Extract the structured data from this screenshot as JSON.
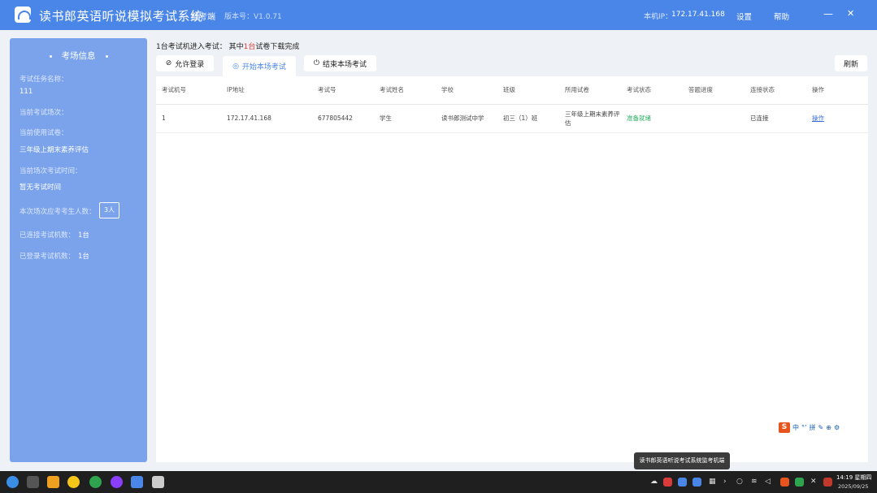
{
  "window": {
    "app_title": "读书郎英语听说模拟考试系统",
    "role": "监考端",
    "version": "版本号：V1.0.71",
    "local_ip_label": "本机IP：",
    "local_ip_value": "172.17.41.168",
    "menu_settings": "设置",
    "menu_help": "帮助",
    "minimize": "—",
    "close": "✕"
  },
  "left_panel": {
    "title": "考场信息",
    "task_name_label": "考试任务名称：",
    "task_name_value": "111",
    "current_session_label": "当前考试场次：",
    "current_paper_label": "当前使用试卷：",
    "current_paper_value": "三年级上期末素养评估",
    "exam_time_label": "当前场次考试时间：",
    "exam_time_value": "暂无考试时间",
    "expected_count_label": "本次场次应考考生人数：",
    "expected_count_value": "3人",
    "connected_label": "已连接考试机数：",
    "connected_value": "1台",
    "logged_in_label": "已登录考试机数：",
    "logged_in_value": "1台"
  },
  "summary": {
    "prefix": "1台考试机进入考试：  其中",
    "highlight": "1台",
    "suffix": "试卷下载完成"
  },
  "toolbar": {
    "allow_login": "允许登录",
    "start_exam": "开始本场考试",
    "end_exam": "结束本场考试",
    "refresh": "刷新"
  },
  "table": {
    "headers": [
      "考试机号",
      "IP地址",
      "考试号",
      "考试姓名",
      "学校",
      "班级",
      "所用试卷",
      "考试状态",
      "答题进度",
      "连接状态",
      "操作"
    ],
    "rows": [
      {
        "machine_no": "1",
        "ip": "172.17.41.168",
        "exam_no": "677805442",
        "name": "学生",
        "school": "读书郎测试中学",
        "class": "初三（1）班",
        "paper": "三年级上期末素养评估",
        "status": "准备就绪",
        "progress": "",
        "connection": "已连接",
        "action": "操作"
      }
    ]
  },
  "ime": {
    "items": [
      "中",
      "°’",
      "拼",
      "✎",
      "⊕",
      "⚙"
    ]
  },
  "tooltip": "读书郎英语听说考试系统监考机端",
  "taskbar": {
    "time": "14:19 星期四",
    "date": "2025/09/25"
  },
  "colors": {
    "titlebar": "#4a86e8",
    "panel": "#7aa3ec",
    "status_ready": "#27ae60",
    "highlight": "#e53935"
  }
}
